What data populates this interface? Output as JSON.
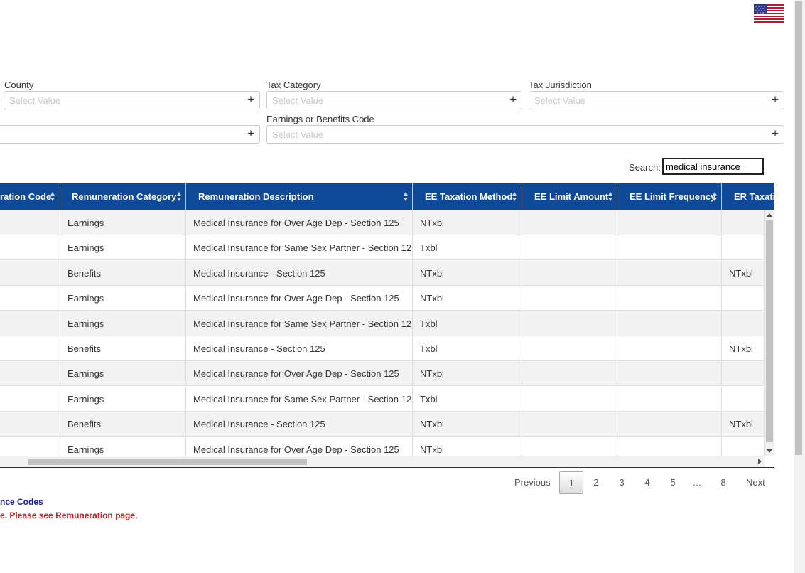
{
  "flag_icon": "us-flag-icon",
  "filters": {
    "county": {
      "label": "County",
      "placeholder": "Select Value"
    },
    "tax_category": {
      "label": "Tax Category",
      "placeholder": "Select Value"
    },
    "tax_jurisdiction": {
      "label": "Tax Jurisdiction",
      "placeholder": "Select Value"
    },
    "left_second": {
      "placeholder": ""
    },
    "earnings_benefits_code": {
      "label": "Earnings or Benefits Code",
      "placeholder": "Select Value"
    }
  },
  "search": {
    "label": "Search:",
    "value": "medical insurance"
  },
  "table": {
    "columns": [
      "ration Code",
      "Remuneration Category",
      "Remuneration Description",
      "EE Taxation Method",
      "EE Limit Amount",
      "EE Limit Frequency",
      "ER Taxatio"
    ],
    "rows": [
      {
        "category": "Earnings",
        "description": "Medical Insurance for Over Age Dep - Section 125",
        "ee_method": "NTxbl",
        "er_method": ""
      },
      {
        "category": "Earnings",
        "description": "Medical Insurance for Same Sex Partner - Section 125",
        "ee_method": "Txbl",
        "er_method": ""
      },
      {
        "category": "Benefits",
        "description": "Medical Insurance - Section 125",
        "ee_method": "NTxbl",
        "er_method": "NTxbl"
      },
      {
        "category": "Earnings",
        "description": "Medical Insurance for Over Age Dep - Section 125",
        "ee_method": "NTxbl",
        "er_method": ""
      },
      {
        "category": "Earnings",
        "description": "Medical Insurance for Same Sex Partner - Section 125",
        "ee_method": "Txbl",
        "er_method": ""
      },
      {
        "category": "Benefits",
        "description": "Medical Insurance - Section 125",
        "ee_method": "Txbl",
        "er_method": "NTxbl"
      },
      {
        "category": "Earnings",
        "description": "Medical Insurance for Over Age Dep - Section 125",
        "ee_method": "NTxbl",
        "er_method": ""
      },
      {
        "category": "Earnings",
        "description": "Medical Insurance for Same Sex Partner - Section 125",
        "ee_method": "Txbl",
        "er_method": ""
      },
      {
        "category": "Benefits",
        "description": "Medical Insurance - Section 125",
        "ee_method": "NTxbl",
        "er_method": "NTxbl"
      },
      {
        "category": "Earnings",
        "description": "Medical Insurance for Over Age Dep - Section 125",
        "ee_method": "NTxbl",
        "er_method": ""
      }
    ]
  },
  "pagination": {
    "previous": "Previous",
    "pages": [
      "1",
      "2",
      "3",
      "4",
      "5",
      "…",
      "8"
    ],
    "current": "1",
    "next": "Next"
  },
  "notes": {
    "blue": "nce Codes",
    "red": "e. Please see Remuneration page."
  },
  "colors": {
    "header_bg": "#0f4a99",
    "note_blue": "#1a1aa6",
    "note_red": "#d61b1b"
  }
}
